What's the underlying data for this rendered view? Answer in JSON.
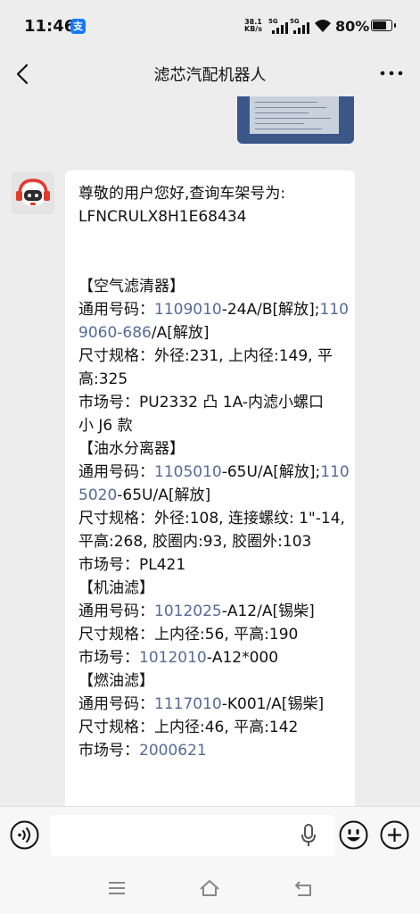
{
  "status_bar": {
    "time": "11:46",
    "alipay_badge": "支",
    "net_speed_value": "38.1",
    "net_speed_unit": "KB/s",
    "sim1_label": "5G",
    "sim2_label": "5G",
    "battery_text": "80%",
    "battery_level": 0.8
  },
  "header": {
    "title": "滤芯汽配机器人"
  },
  "message": {
    "greeting": "尊敬的用户您好,查询车架号为:",
    "vin": "LFNCRULX8H1E68434",
    "sections": [
      {
        "name": "【空气滤清器】",
        "general_label": " 通用号码：",
        "general_parts": [
          {
            "text": "1109010",
            "link": true
          },
          {
            "text": "-24A/B[解放];",
            "link": false
          },
          {
            "text": "1109060-686",
            "link": true
          },
          {
            "text": "/A[解放]",
            "link": false
          }
        ],
        "spec": " 尺寸规格：外径:231, 上内径:149, 平高:325",
        "market_label": " 市场号：",
        "market_parts": [
          {
            "text": "PU2332 凸 1A-内滤小螺口　　　　　小 J6 款",
            "link": false
          }
        ]
      },
      {
        "name": "【油水分离器】",
        "general_label": " 通用号码：",
        "general_parts": [
          {
            "text": "1105010",
            "link": true
          },
          {
            "text": "-65U/A[解放];",
            "link": false
          },
          {
            "text": "1105020",
            "link": true
          },
          {
            "text": "-65U/A[解放]",
            "link": false
          }
        ],
        "spec": " 尺寸规格：外径:108, 连接螺纹: 1\"-14, 平高:268, 胶圈内:93, 胶圈外:103",
        "market_label": " 市场号：",
        "market_parts": [
          {
            "text": "PL421",
            "link": false
          }
        ]
      },
      {
        "name": "【机油滤】",
        "general_label": " 通用号码：",
        "general_parts": [
          {
            "text": "1012025",
            "link": true
          },
          {
            "text": "-A12/A[锡柴]",
            "link": false
          }
        ],
        "spec": " 尺寸规格：上内径:56, 平高:190",
        "market_label": " 市场号：",
        "market_parts": [
          {
            "text": "1012010",
            "link": true
          },
          {
            "text": "-A12*000",
            "link": false
          }
        ]
      },
      {
        "name": "【燃油滤】",
        "general_label": " 通用号码：",
        "general_parts": [
          {
            "text": "1117010",
            "link": true
          },
          {
            "text": "-K001/A[锡柴]",
            "link": false
          }
        ],
        "spec": " 尺寸规格：上内径:46, 平高:142",
        "market_label": " 市场号：",
        "market_parts": [
          {
            "text": "2000621",
            "link": true
          }
        ]
      }
    ]
  },
  "colors": {
    "background": "#ededed",
    "bubble": "#ffffff",
    "link": "#546b96",
    "bar": "#f7f7f7"
  },
  "icons": {
    "back": "back-arrow-icon",
    "more": "more-dots-icon",
    "voice": "voice-input-icon",
    "mic": "microphone-icon",
    "emoji": "emoji-icon",
    "add": "plus-icon",
    "nav_menu": "menu-icon",
    "nav_home": "home-icon",
    "nav_back": "back-nav-icon"
  }
}
